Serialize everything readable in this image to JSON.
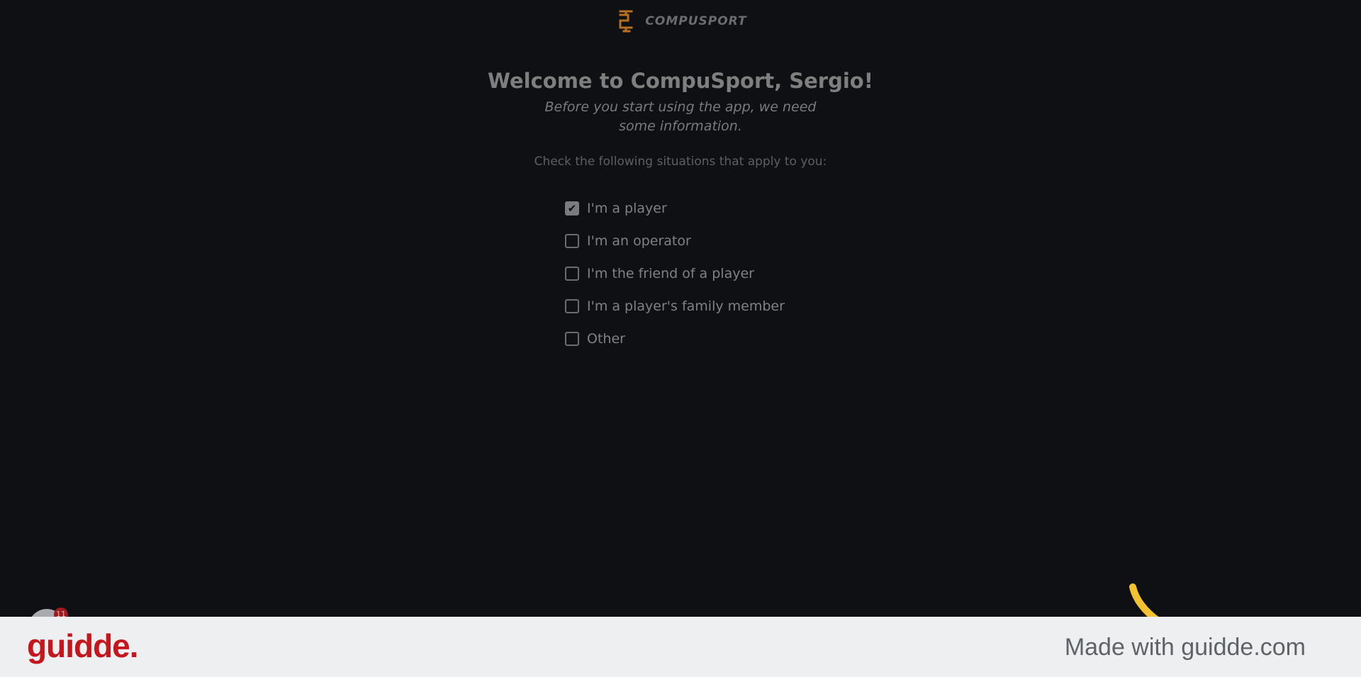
{
  "brand": {
    "name": "COMPUSPORT",
    "color": "#b8701e"
  },
  "welcome": {
    "title": "Welcome to CompuSport, Sergio!",
    "subtitle": "Before you start using the app, we need some information.",
    "prompt": "Check the following situations that apply to you:"
  },
  "options": [
    {
      "label": "I'm a player",
      "checked": true
    },
    {
      "label": "I'm an operator",
      "checked": false
    },
    {
      "label": "I'm the friend of a player",
      "checked": false
    },
    {
      "label": "I'm a player's family member",
      "checked": false
    },
    {
      "label": "Other",
      "checked": false
    }
  ],
  "widget": {
    "badge_count": "11"
  },
  "footer": {
    "logo": "guidde.",
    "made_with": "Made with guidde.com",
    "logo_color": "#c4161c"
  }
}
